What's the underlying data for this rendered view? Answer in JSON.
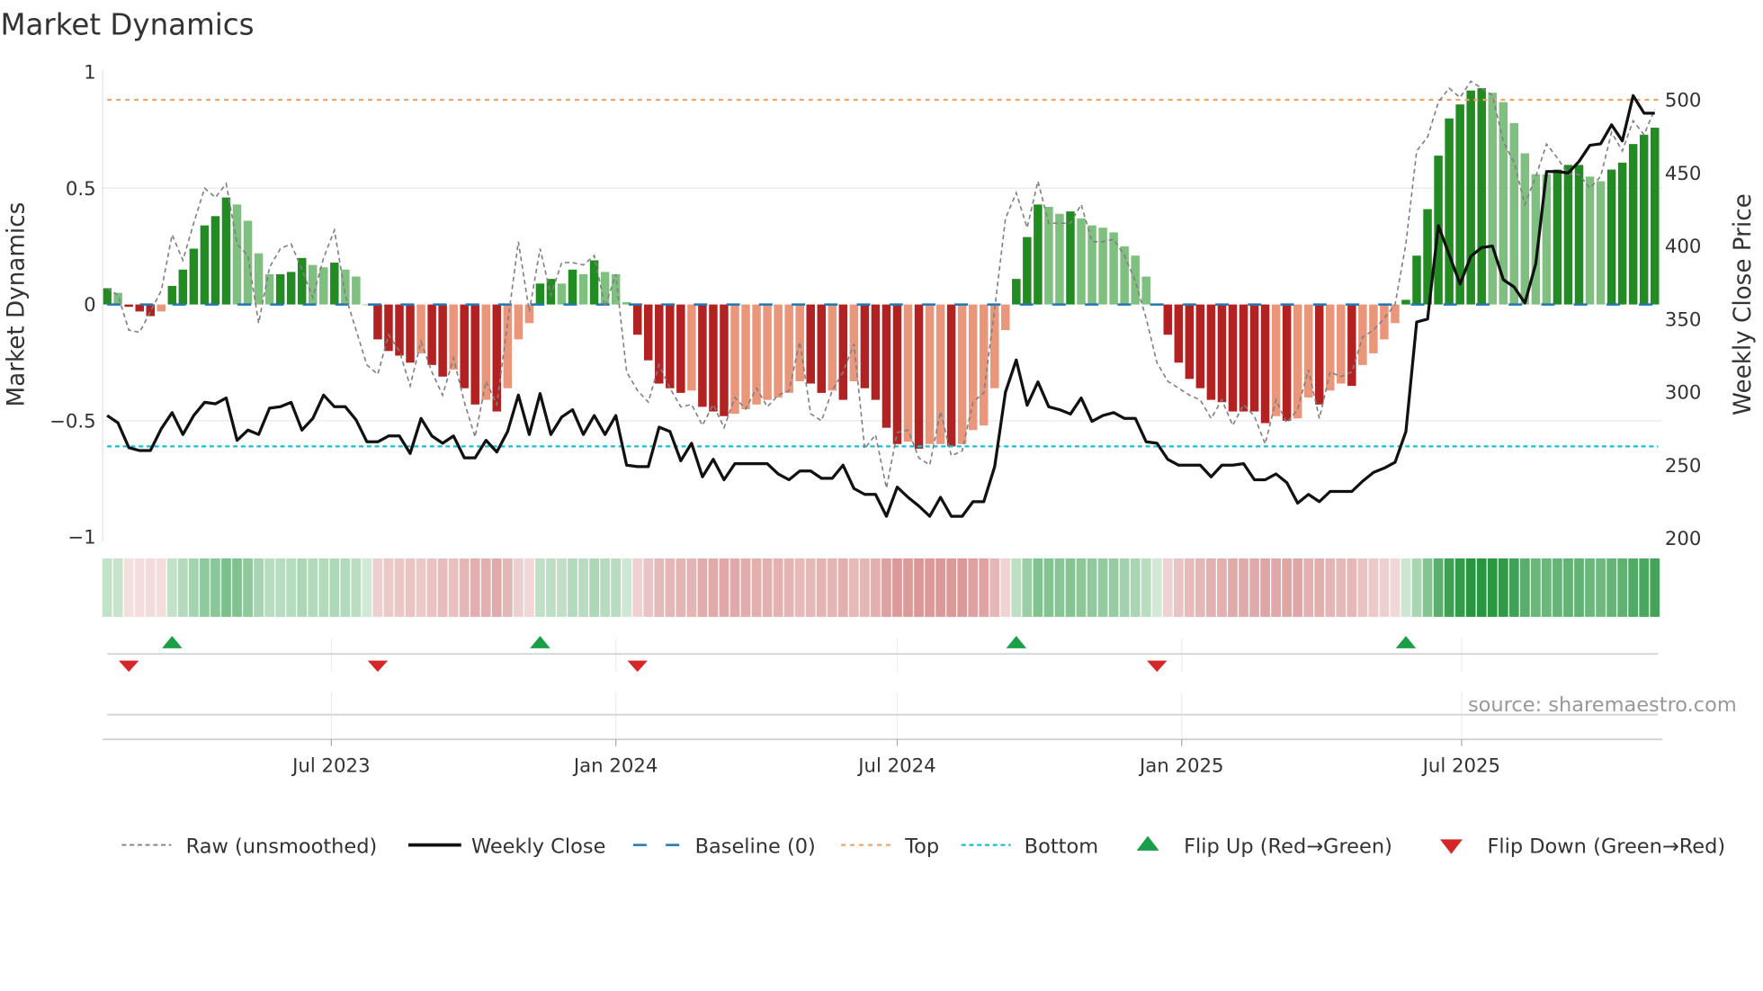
{
  "title": "Market Dynamics",
  "source": "source: sharemaestro.com",
  "colors": {
    "bar_green_dark": "#228b22",
    "bar_green_light": "#7fbf7f",
    "bar_red_dark": "#b22222",
    "bar_red_light": "#e9967a",
    "raw": "#808080",
    "close": "#111111",
    "baseline": "#1f77b4",
    "top": "#f4a460",
    "bottom": "#17becf",
    "flip_up": "#1a9e47",
    "flip_down": "#d62728"
  },
  "chart_data": {
    "type": "bar",
    "start_date": "2023-02-06",
    "frequency": "weekly",
    "left_axis": {
      "label": "Market Dynamics",
      "ylim": [
        -1,
        1
      ],
      "ticks": [
        {
          "v": 1,
          "label": "1"
        },
        {
          "v": 0.5,
          "label": "0.5"
        },
        {
          "v": 0,
          "label": "0"
        },
        {
          "v": -0.5,
          "label": "−0.5"
        },
        {
          "v": -1,
          "label": "−1"
        }
      ]
    },
    "right_axis": {
      "label": "Weekly Close Price",
      "ylim": [
        200,
        500
      ],
      "ticks": [
        {
          "v": 500,
          "label": "500"
        },
        {
          "v": 450,
          "label": "450"
        },
        {
          "v": 400,
          "label": "400"
        },
        {
          "v": 350,
          "label": "350"
        },
        {
          "v": 300,
          "label": "300"
        },
        {
          "v": 250,
          "label": "250"
        },
        {
          "v": 200,
          "label": "200"
        }
      ]
    },
    "x_ticks": [
      {
        "label": "Jul 2023",
        "date": "2023-07-01"
      },
      {
        "label": "Jan 2024",
        "date": "2024-01-01"
      },
      {
        "label": "Jul 2024",
        "date": "2024-07-01"
      },
      {
        "label": "Jan 2025",
        "date": "2025-01-01"
      },
      {
        "label": "Jul 2025",
        "date": "2025-07-01"
      }
    ],
    "thresholds": {
      "baseline": 0,
      "top": 0.88,
      "bottom": -0.61
    },
    "momentum": [
      0.07,
      0.05,
      -0.01,
      -0.03,
      -0.05,
      -0.03,
      0.08,
      0.15,
      0.24,
      0.34,
      0.38,
      0.46,
      0.43,
      0.36,
      0.22,
      0.13,
      0.13,
      0.14,
      0.2,
      0.17,
      0.16,
      0.18,
      0.15,
      0.12,
      0.0,
      -0.15,
      -0.2,
      -0.22,
      -0.25,
      -0.21,
      -0.26,
      -0.31,
      -0.28,
      -0.36,
      -0.43,
      -0.41,
      -0.46,
      -0.36,
      -0.15,
      -0.08,
      0.09,
      0.11,
      0.09,
      0.15,
      0.13,
      0.19,
      0.14,
      0.13,
      0.01,
      -0.13,
      -0.24,
      -0.34,
      -0.36,
      -0.38,
      -0.37,
      -0.44,
      -0.46,
      -0.48,
      -0.47,
      -0.45,
      -0.43,
      -0.41,
      -0.4,
      -0.38,
      -0.33,
      -0.34,
      -0.38,
      -0.37,
      -0.41,
      -0.33,
      -0.36,
      -0.41,
      -0.53,
      -0.6,
      -0.59,
      -0.62,
      -0.6,
      -0.6,
      -0.61,
      -0.6,
      -0.54,
      -0.52,
      -0.36,
      -0.11,
      0.11,
      0.29,
      0.43,
      0.42,
      0.39,
      0.4,
      0.37,
      0.34,
      0.33,
      0.31,
      0.25,
      0.21,
      0.12,
      0.0,
      -0.13,
      -0.25,
      -0.32,
      -0.36,
      -0.41,
      -0.42,
      -0.46,
      -0.46,
      -0.46,
      -0.51,
      -0.48,
      -0.5,
      -0.49,
      -0.4,
      -0.43,
      -0.37,
      -0.34,
      -0.35,
      -0.26,
      -0.21,
      -0.15,
      -0.08,
      0.02,
      0.21,
      0.41,
      0.64,
      0.8,
      0.86,
      0.92,
      0.93,
      0.91,
      0.87,
      0.78,
      0.65,
      0.56,
      0.56,
      0.58,
      0.6,
      0.6,
      0.55,
      0.53,
      0.58,
      0.61,
      0.69,
      0.73,
      0.76
    ],
    "momentum_strengthening": [
      1,
      0,
      1,
      1,
      1,
      0,
      1,
      1,
      1,
      1,
      1,
      1,
      0,
      0,
      0,
      0,
      1,
      1,
      1,
      0,
      0,
      1,
      0,
      0,
      0,
      1,
      1,
      1,
      1,
      0,
      1,
      1,
      0,
      1,
      1,
      0,
      1,
      0,
      0,
      0,
      1,
      1,
      0,
      1,
      0,
      1,
      0,
      0,
      0,
      1,
      1,
      1,
      1,
      1,
      0,
      1,
      1,
      1,
      0,
      0,
      0,
      0,
      0,
      0,
      0,
      1,
      1,
      0,
      1,
      0,
      1,
      1,
      1,
      1,
      0,
      1,
      0,
      0,
      1,
      0,
      0,
      0,
      0,
      0,
      1,
      1,
      1,
      0,
      0,
      1,
      0,
      0,
      0,
      0,
      0,
      0,
      0,
      0,
      1,
      1,
      1,
      1,
      1,
      1,
      1,
      1,
      1,
      1,
      0,
      1,
      0,
      0,
      1,
      0,
      0,
      1,
      0,
      0,
      0,
      0,
      1,
      1,
      1,
      1,
      1,
      1,
      1,
      1,
      0,
      0,
      0,
      0,
      0,
      0,
      1,
      1,
      1,
      0,
      0,
      1,
      1,
      1,
      1,
      1
    ],
    "raw": [
      0.07,
      0.04,
      -0.11,
      -0.12,
      -0.03,
      0.06,
      0.3,
      0.19,
      0.35,
      0.5,
      0.46,
      0.52,
      0.26,
      0.21,
      -0.08,
      0.16,
      0.24,
      0.26,
      0.15,
      0.03,
      0.2,
      0.32,
      0.04,
      -0.11,
      -0.26,
      -0.3,
      -0.13,
      -0.2,
      -0.35,
      -0.16,
      -0.29,
      -0.39,
      -0.23,
      -0.42,
      -0.57,
      -0.33,
      -0.43,
      -0.08,
      0.27,
      -0.03,
      0.24,
      0.04,
      0.18,
      0.18,
      0.17,
      0.21,
      -0.01,
      0.13,
      -0.29,
      -0.37,
      -0.42,
      -0.26,
      -0.36,
      -0.44,
      -0.43,
      -0.52,
      -0.43,
      -0.53,
      -0.4,
      -0.45,
      -0.36,
      -0.44,
      -0.39,
      -0.37,
      -0.16,
      -0.47,
      -0.5,
      -0.37,
      -0.29,
      -0.17,
      -0.62,
      -0.56,
      -0.79,
      -0.55,
      -0.54,
      -0.66,
      -0.69,
      -0.46,
      -0.65,
      -0.63,
      -0.42,
      -0.38,
      -0.02,
      0.37,
      0.48,
      0.33,
      0.53,
      0.35,
      0.35,
      0.35,
      0.43,
      0.27,
      0.27,
      0.28,
      0.21,
      0.1,
      -0.06,
      -0.25,
      -0.33,
      -0.36,
      -0.39,
      -0.41,
      -0.49,
      -0.41,
      -0.52,
      -0.43,
      -0.48,
      -0.6,
      -0.41,
      -0.51,
      -0.45,
      -0.28,
      -0.49,
      -0.29,
      -0.31,
      -0.29,
      -0.14,
      -0.11,
      -0.06,
      0.0,
      0.26,
      0.66,
      0.72,
      0.87,
      0.93,
      0.89,
      0.96,
      0.93,
      0.9,
      0.7,
      0.61,
      0.43,
      0.55,
      0.69,
      0.63,
      0.56,
      0.56,
      0.5,
      0.55,
      0.74,
      0.66,
      0.79,
      0.73,
      0.84
    ],
    "close": [
      284,
      279,
      262,
      260,
      260,
      275,
      286,
      271,
      284,
      293,
      292,
      296,
      267,
      274,
      271,
      289,
      290,
      293,
      274,
      282,
      298,
      290,
      290,
      281,
      266,
      266,
      270,
      270,
      258,
      282,
      270,
      265,
      270,
      255,
      255,
      267,
      259,
      273,
      298,
      271,
      299,
      271,
      283,
      288,
      271,
      284,
      271,
      284,
      250,
      249,
      249,
      276,
      273,
      253,
      265,
      242,
      254,
      240,
      251,
      251,
      251,
      251,
      244,
      240,
      246,
      246,
      241,
      241,
      250,
      234,
      230,
      230,
      215,
      235,
      228,
      222,
      215,
      228,
      215,
      215,
      225,
      225,
      249,
      300,
      322,
      291,
      307,
      290,
      288,
      285,
      296,
      280,
      284,
      286,
      282,
      282,
      266,
      265,
      254,
      250,
      250,
      250,
      242,
      250,
      250,
      251,
      240,
      240,
      244,
      238,
      224,
      230,
      225,
      232,
      232,
      232,
      239,
      245,
      248,
      252,
      273,
      348,
      350,
      414,
      394,
      374,
      393,
      399,
      400,
      377,
      372,
      361,
      388,
      451,
      451,
      450,
      458,
      469,
      470,
      483,
      472,
      503,
      491,
      491
    ],
    "flip_up_dates": [
      "2023-03-20",
      "2023-11-13",
      "2024-09-16",
      "2025-05-26"
    ],
    "flip_down_dates": [
      "2023-02-20",
      "2023-07-31",
      "2024-01-15",
      "2024-12-16"
    ],
    "legend": [
      {
        "label": "Raw (unsmoothed)",
        "kind": "raw"
      },
      {
        "label": "Weekly Close",
        "kind": "close"
      },
      {
        "label": "Baseline (0)",
        "kind": "baseline"
      },
      {
        "label": "Top",
        "kind": "top"
      },
      {
        "label": "Bottom",
        "kind": "bottom"
      },
      {
        "label": "Flip Up (Red→Green)",
        "kind": "flip_up"
      },
      {
        "label": "Flip Down (Green→Red)",
        "kind": "flip_down"
      }
    ]
  }
}
